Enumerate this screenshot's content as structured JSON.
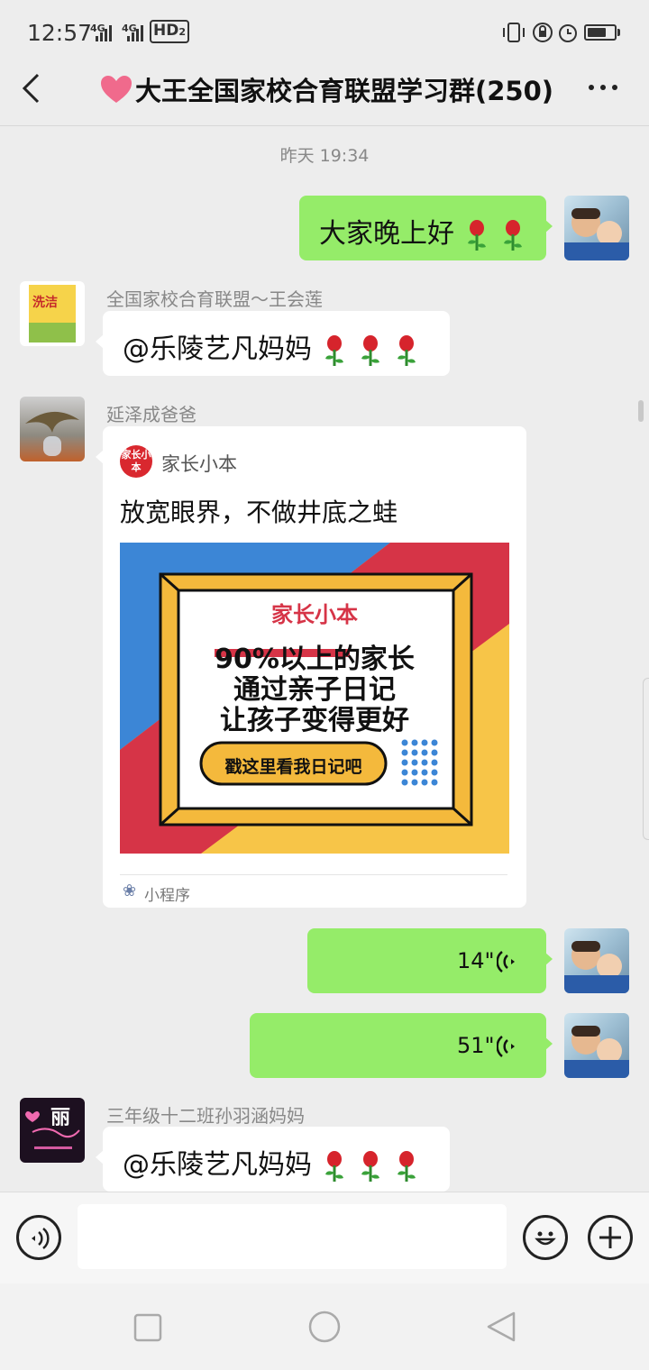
{
  "status_bar": {
    "time": "12:57",
    "network1": "4G",
    "network2": "4G",
    "hd": "HD",
    "hd_sub": "2"
  },
  "header": {
    "title": "大王全国家校合育联盟学习群(250)",
    "back_icon": "chevron-left-icon",
    "more_icon": "more-icon"
  },
  "chat": {
    "timestamp": "昨天 19:34",
    "messages": [
      {
        "side": "right",
        "text": "大家晚上好"
      },
      {
        "side": "left",
        "sender": "全国家校合育联盟～王会莲",
        "text": "@乐陵艺凡妈妈"
      },
      {
        "side": "left",
        "sender": "延泽成爸爸",
        "card": {
          "logo_text": "家长小本",
          "app_name": "家长小本",
          "desc": "放宽眼界，不做井底之蛙",
          "poster_brand": "家长小本",
          "poster_line1": "90%以上的家长",
          "poster_line2": "通过亲子日记",
          "poster_line3": "让孩子变得更好",
          "poster_button": "戳这里看我日记吧",
          "tag": "小程序"
        }
      },
      {
        "side": "right",
        "voice": "14\""
      },
      {
        "side": "right",
        "voice": "51\""
      },
      {
        "side": "left",
        "sender": "三年级十二班孙羽涵妈妈",
        "text": "@乐陵艺凡妈妈"
      }
    ],
    "avatar3_text": "丽"
  },
  "colors": {
    "green_bubble": "#95ec69",
    "background": "#ededed",
    "poster_red": "#d63447",
    "poster_blue": "#3c86d6",
    "poster_yellow": "#f7c548"
  },
  "navbar": {
    "square_icon": "recent-apps-icon",
    "circle_icon": "home-icon",
    "triangle_icon": "back-icon"
  }
}
